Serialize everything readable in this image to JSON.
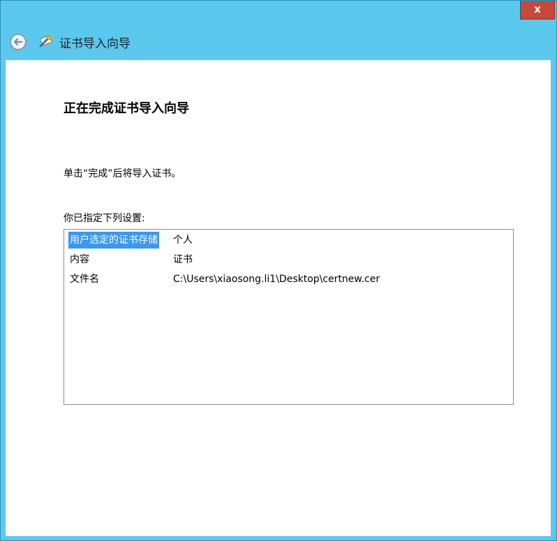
{
  "window": {
    "title": "证书导入向导",
    "close_label": "x"
  },
  "wizard": {
    "heading": "正在完成证书导入向导",
    "instruction": "单击“完成”后将导入证书。",
    "settings_label": "你已指定下列设置:",
    "settings": [
      {
        "key": "用户选定的证书存储",
        "value": "个人",
        "selected": true
      },
      {
        "key": "内容",
        "value": "证书",
        "selected": false
      },
      {
        "key": "文件名",
        "value": "C:\\Users\\xiaosong.li1\\Desktop\\certnew.cer",
        "selected": false
      }
    ]
  },
  "colors": {
    "frame": "#5bc8ee",
    "close": "#c7493a",
    "selection": "#3399ff"
  },
  "icons": {
    "back": "back-arrow-icon",
    "wizard": "certificate-wizard-icon"
  }
}
